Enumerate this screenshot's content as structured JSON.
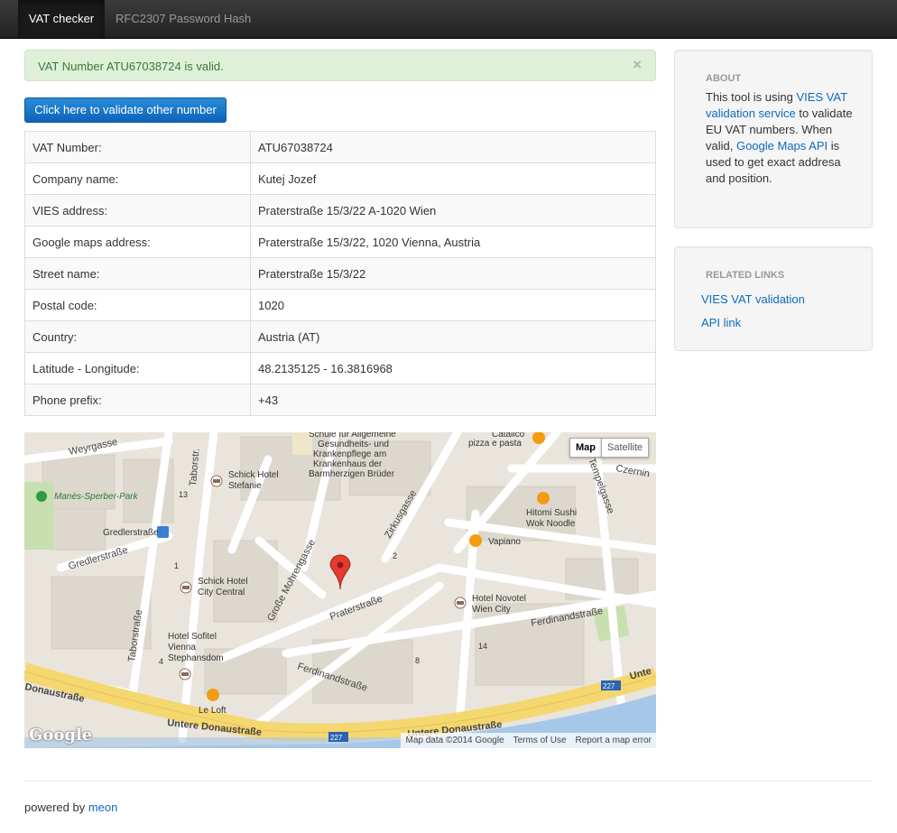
{
  "navbar": {
    "items": [
      {
        "label": "VAT checker",
        "active": true
      },
      {
        "label": "RFC2307 Password Hash",
        "active": false
      }
    ]
  },
  "alert": {
    "message": "VAT Number ATU67038724 is valid.",
    "close": "×",
    "color": "#3c763d"
  },
  "validate_button": {
    "label": "Click here to validate other number"
  },
  "details": [
    {
      "label": "VAT Number:",
      "value": "ATU67038724"
    },
    {
      "label": "Company name:",
      "value": "Kutej Jozef"
    },
    {
      "label": "VIES address:",
      "value": "Praterstraße 15/3/22 A-1020 Wien"
    },
    {
      "label": "Google maps address:",
      "value": "Praterstraße 15/3/22, 1020 Vienna, Austria"
    },
    {
      "label": "Street name:",
      "value": "Praterstraße 15/3/22"
    },
    {
      "label": "Postal code:",
      "value": "1020"
    },
    {
      "label": "Country:",
      "value": "Austria (AT)"
    },
    {
      "label": "Latitude - Longitude:",
      "value": "48.2135125 - 16.3816968"
    },
    {
      "label": "Phone prefix:",
      "value": "+43"
    }
  ],
  "map": {
    "type_map": "Map",
    "type_satellite": "Satellite",
    "logo": "Google",
    "footer": {
      "data": "Map data ©2014 Google",
      "terms": "Terms of Use",
      "report": "Report a map error"
    },
    "labels": {
      "weyrgasse": "Weyrgasse",
      "taborstrasse_top": "Taborstr.",
      "schule": "Schule für Allgemeine",
      "gesundheits": "Gesundheits- und",
      "krankenpflege": "Krankenpflege am",
      "krankenhaus": "Krankenhaus der",
      "barmherzigen": "Barmherzigen Brüder",
      "catalico": "Catalico",
      "pizza": "pizza e pasta",
      "tempelgasse": "Tempelgasse",
      "czernin": "Czernin",
      "schick_stefanie_1": "Schick Hotel",
      "schick_stefanie_2": "Stefanie",
      "manes_sperber": "Manès-Sperber-Park",
      "gredlerstrasse_station": "Gredlerstraße",
      "gredlerstrasse": "Gredlerstraße",
      "zirkusgasse": "Zirkusgasse",
      "hitomi_1": "Hitomi Sushi",
      "hitomi_2": "Wok Noodle",
      "vapiano": "Vapiano",
      "grosse_mohrengasse": "Große Mohrengasse",
      "schick_city_1": "Schick Hotel",
      "schick_city_2": "City Central",
      "praterstrasse": "Praterstraße",
      "novotel_1": "Hotel Novotel",
      "novotel_2": "Wien City",
      "ferdinandstrasse_right": "Ferdinandstraße",
      "taborstrasse": "Taborstraße",
      "sofitel_1": "Hotel Sofitel",
      "sofitel_2": "Vienna",
      "sofitel_3": "Stephansdom",
      "ferdinandstrasse": "Ferdinandstraße",
      "donaustrasse_left": "Donaustraße",
      "le_loft": "Le Loft",
      "untere_1": "Untere Donaustraße",
      "untere_2": "Untere Donaustraße",
      "unte": "Unte",
      "num_227a": "227",
      "num_227b": "227",
      "num_13": "13",
      "num_14": "14",
      "num_8": "8",
      "num_4": "4",
      "num_1": "1",
      "num_2": "2"
    }
  },
  "sidebar": {
    "about": {
      "heading": "ABOUT",
      "text_1": "This tool is using ",
      "link_1": "VIES VAT validation service",
      "text_2": " to validate EU VAT numbers. When valid, ",
      "link_2": "Google Maps API",
      "text_3": " is used to get exact addresa and position."
    },
    "related": {
      "heading": "RELATED LINKS",
      "links": [
        "VIES VAT validation",
        "API link"
      ]
    }
  },
  "footer": {
    "prefix": "powered by ",
    "link": "meon"
  }
}
